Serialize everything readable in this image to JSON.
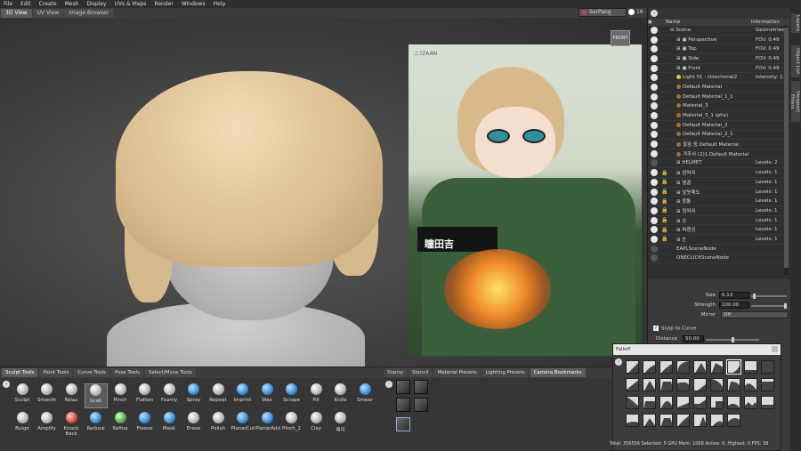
{
  "menu": [
    "File",
    "Edit",
    "Create",
    "Mesh",
    "Display",
    "UVs & Maps",
    "Render",
    "Windows",
    "Help"
  ],
  "view_tabs": [
    {
      "label": "3D View",
      "active": true
    },
    {
      "label": "UV View",
      "active": false
    },
    {
      "label": "Image Browser",
      "active": false
    }
  ],
  "camera": {
    "name": "SerPang",
    "value": "16"
  },
  "viewport": {
    "cube_label": "FRONT"
  },
  "reference": {
    "tag": "ニ?ZAAN",
    "title": "瞳田吉"
  },
  "right_rail": [
    "Layers",
    "Object List",
    "Viewport Filters"
  ],
  "layers": {
    "col_name": "Name",
    "col_info": "Information",
    "rows": [
      {
        "name": "⊟ Scene",
        "info": "Geometries",
        "eye": true,
        "lock": false,
        "indent": 0,
        "kind": "scene"
      },
      {
        "name": "⊞ ▣ Perspective",
        "info": "FOV: 0.49",
        "eye": true,
        "lock": false,
        "indent": 1,
        "kind": "cam"
      },
      {
        "name": "⊞ ▣ Top",
        "info": "FOV: 0.49",
        "eye": true,
        "lock": false,
        "indent": 1,
        "kind": "cam"
      },
      {
        "name": "⊞ ▣ Side",
        "info": "FOV: 0.49",
        "eye": true,
        "lock": false,
        "indent": 1,
        "kind": "cam"
      },
      {
        "name": "⊞ ▣ Front",
        "info": "FOV: 0.49",
        "eye": true,
        "lock": false,
        "indent": 1,
        "kind": "cam"
      },
      {
        "name": "Light 01 - Directional2",
        "info": "Intensity: 1.0",
        "eye": true,
        "lock": false,
        "indent": 1,
        "kind": "light"
      },
      {
        "name": "Default Material",
        "info": "",
        "eye": true,
        "lock": false,
        "indent": 1,
        "kind": "mat"
      },
      {
        "name": "Default Material_1_1",
        "info": "",
        "eye": true,
        "lock": false,
        "indent": 1,
        "kind": "mat"
      },
      {
        "name": "Material_3",
        "info": "",
        "eye": true,
        "lock": false,
        "indent": 1,
        "kind": "mat"
      },
      {
        "name": "Material_5_1 (phx)",
        "info": "",
        "eye": true,
        "lock": false,
        "indent": 1,
        "kind": "mat"
      },
      {
        "name": "Default Material_2",
        "info": "",
        "eye": true,
        "lock": false,
        "indent": 1,
        "kind": "mat"
      },
      {
        "name": "Default Material_2_1",
        "info": "",
        "eye": true,
        "lock": false,
        "indent": 1,
        "kind": "mat"
      },
      {
        "name": "팔꿈 중.Default Material",
        "info": "",
        "eye": true,
        "lock": false,
        "indent": 1,
        "kind": "mat"
      },
      {
        "name": "겨추사 (2)1.Default Material",
        "info": "",
        "eye": true,
        "lock": false,
        "indent": 1,
        "kind": "mat"
      },
      {
        "name": "⊞ HELMET",
        "info": "Levels: 2",
        "eye": false,
        "lock": false,
        "indent": 1,
        "kind": "layer"
      },
      {
        "name": "⊞ 왼머리",
        "info": "Levels: 1",
        "eye": true,
        "lock": true,
        "indent": 1,
        "kind": "layer"
      },
      {
        "name": "⊞ 옆꿀",
        "info": "Levels: 1",
        "eye": true,
        "lock": true,
        "indent": 1,
        "kind": "layer"
      },
      {
        "name": "⊞ 앞옷매도",
        "info": "Levels: 1",
        "eye": true,
        "lock": true,
        "indent": 1,
        "kind": "layer"
      },
      {
        "name": "⊞ 뭉통",
        "info": "Levels: 1",
        "eye": true,
        "lock": true,
        "indent": 1,
        "kind": "layer"
      },
      {
        "name": "⊞ 뒷머리",
        "info": "Levels: 1",
        "eye": true,
        "lock": true,
        "indent": 1,
        "kind": "layer"
      },
      {
        "name": "⊞ 손",
        "info": "Levels: 1",
        "eye": true,
        "lock": true,
        "indent": 1,
        "kind": "layer"
      },
      {
        "name": "⊞ 퍼렌싱",
        "info": "Levels: 1",
        "eye": true,
        "lock": true,
        "indent": 1,
        "kind": "layer"
      },
      {
        "name": "⊞ 눈",
        "info": "Levels: 1",
        "eye": true,
        "lock": true,
        "indent": 1,
        "kind": "layer"
      },
      {
        "name": "EAPLSceneNode",
        "info": "",
        "eye": false,
        "lock": false,
        "indent": 1,
        "kind": "node"
      },
      {
        "name": "ONECLICKSceneNode",
        "info": "",
        "eye": false,
        "lock": false,
        "indent": 1,
        "kind": "node"
      }
    ]
  },
  "properties": {
    "size": {
      "label": "Size",
      "value": "6.13",
      "level": 0.05
    },
    "strength": {
      "label": "Strength",
      "value": "100.00",
      "level": 1.0
    },
    "mirror": {
      "label": "Mirror",
      "value": "Off"
    },
    "snap": {
      "label": "Snap to Curve",
      "checked": true
    },
    "distance": {
      "label": "Distance",
      "value": "50.00",
      "level": 0.5
    }
  },
  "tool_tabs": [
    {
      "label": "Sculpt Tools",
      "active": true
    },
    {
      "label": "Paint Tools",
      "active": false
    },
    {
      "label": "Curve Tools",
      "active": false
    },
    {
      "label": "Pose Tools",
      "active": false
    },
    {
      "label": "Select/Move Tools",
      "active": false
    }
  ],
  "tools_row1": [
    {
      "label": "Sculpt",
      "style": "grey"
    },
    {
      "label": "Smooth",
      "style": "grey"
    },
    {
      "label": "Relax",
      "style": "grey"
    },
    {
      "label": "Grab",
      "style": "grey",
      "selected": true
    },
    {
      "label": "Pinch",
      "style": "grey"
    },
    {
      "label": "Flatten",
      "style": "grey"
    },
    {
      "label": "Foamy",
      "style": "grey"
    },
    {
      "label": "Spray",
      "style": "blue"
    },
    {
      "label": "Repeat",
      "style": "grey"
    },
    {
      "label": "Imprint",
      "style": "blue"
    },
    {
      "label": "Wax",
      "style": "blue"
    },
    {
      "label": "Scrape",
      "style": "blue"
    },
    {
      "label": "Fill",
      "style": "grey"
    },
    {
      "label": "Knife",
      "style": "grey"
    },
    {
      "label": "Smear",
      "style": "blue"
    }
  ],
  "tools_row2": [
    {
      "label": "Bulge",
      "style": "grey"
    },
    {
      "label": "Amplify",
      "style": "grey"
    },
    {
      "label": "Knock Back",
      "style": "red"
    },
    {
      "label": "Reduce",
      "style": "blue"
    },
    {
      "label": "Refine",
      "style": "green"
    },
    {
      "label": "Freeze",
      "style": "blue"
    },
    {
      "label": "Mask",
      "style": "blue"
    },
    {
      "label": "Erase",
      "style": "grey"
    },
    {
      "label": "Polish",
      "style": "grey"
    },
    {
      "label": "PlanarCut",
      "style": "blue"
    },
    {
      "label": "PlanarAdd",
      "style": "blue"
    },
    {
      "label": "Pinch_2",
      "style": "grey"
    },
    {
      "label": "Clay",
      "style": "grey"
    },
    {
      "label": "패미",
      "style": "grey"
    }
  ],
  "stamp_tabs": [
    {
      "label": "Stamp",
      "active": false
    },
    {
      "label": "Stencil",
      "active": false
    },
    {
      "label": "Material Presets",
      "active": false
    },
    {
      "label": "Lighting Presets",
      "active": false
    },
    {
      "label": "Camera Bookmarks",
      "active": true
    }
  ],
  "falloff": {
    "title": "Falloff",
    "selected_index": 6
  },
  "status": "Total: 356556  Selected: 5 GPU Mem: 1068  Active: 0, Highest: 0  FPS: 38"
}
